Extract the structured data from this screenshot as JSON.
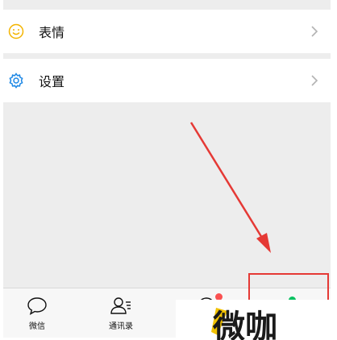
{
  "menu": {
    "items": [
      {
        "label": "表情",
        "icon": "smiley-icon"
      },
      {
        "label": "设置",
        "icon": "gear-icon"
      }
    ]
  },
  "tabbar": {
    "tabs": [
      {
        "label": "微信",
        "icon": "chat-bubble-icon"
      },
      {
        "label": "通讯录",
        "icon": "contacts-icon"
      },
      {
        "label": "",
        "icon": "discover-icon"
      },
      {
        "label": "",
        "icon": "me-icon"
      }
    ]
  },
  "annotation": {
    "color": "#e53935"
  },
  "watermark": {
    "text": "微咖"
  },
  "colors": {
    "smiley": "#f4b400",
    "gear": "#1e88e5",
    "badge": "#fa5151",
    "active": "#07c160"
  }
}
